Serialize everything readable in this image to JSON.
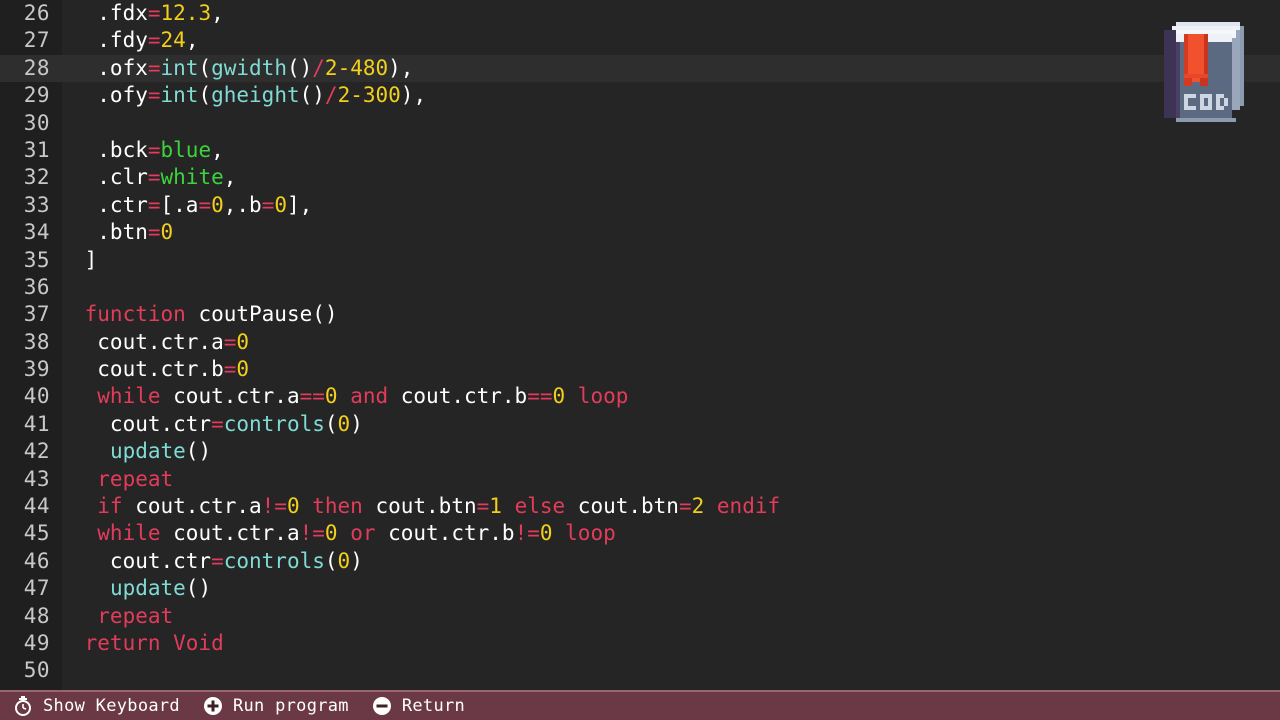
{
  "app": {
    "title": "CODE",
    "logo_label": "CODE"
  },
  "colors": {
    "editor_bg": "#252526",
    "gutter_bg": "#1f1f1f",
    "active_line_bg": "#2e2e2e",
    "line_number": "#c8c8c8",
    "default_text": "#e8e8e8",
    "keyword": "#e23c5a",
    "function": "#7fdbd4",
    "number": "#f2cf1b",
    "constant": "#3cd43c",
    "operator": "#e23c5a",
    "bottombar_bg": "#6b3946",
    "bottombar_border": "#9a6471",
    "bottombar_text": "#ffffff"
  },
  "editor": {
    "active_line": 28,
    "first_visible_line": 26,
    "last_visible_line": 50,
    "lines": [
      {
        "n": 26,
        "tokens": [
          {
            "t": "  .fdx",
            "c": "id"
          },
          {
            "t": "=",
            "c": "op"
          },
          {
            "t": "12.3",
            "c": "num"
          },
          {
            "t": ",",
            "c": "id"
          }
        ]
      },
      {
        "n": 27,
        "tokens": [
          {
            "t": "  .fdy",
            "c": "id"
          },
          {
            "t": "=",
            "c": "op"
          },
          {
            "t": "24",
            "c": "num"
          },
          {
            "t": ",",
            "c": "id"
          }
        ]
      },
      {
        "n": 28,
        "tokens": [
          {
            "t": "  .ofx",
            "c": "id"
          },
          {
            "t": "=",
            "c": "op"
          },
          {
            "t": "int",
            "c": "fn"
          },
          {
            "t": "(",
            "c": "id"
          },
          {
            "t": "gwidth",
            "c": "fn"
          },
          {
            "t": "()",
            "c": "id"
          },
          {
            "t": "/",
            "c": "op"
          },
          {
            "t": "2-480",
            "c": "num"
          },
          {
            "t": "),",
            "c": "id"
          }
        ]
      },
      {
        "n": 29,
        "tokens": [
          {
            "t": "  .ofy",
            "c": "id"
          },
          {
            "t": "=",
            "c": "op"
          },
          {
            "t": "int",
            "c": "fn"
          },
          {
            "t": "(",
            "c": "id"
          },
          {
            "t": "gheight",
            "c": "fn"
          },
          {
            "t": "()",
            "c": "id"
          },
          {
            "t": "/",
            "c": "op"
          },
          {
            "t": "2-300",
            "c": "num"
          },
          {
            "t": "),",
            "c": "id"
          }
        ]
      },
      {
        "n": 30,
        "tokens": []
      },
      {
        "n": 31,
        "tokens": [
          {
            "t": "  .bck",
            "c": "id"
          },
          {
            "t": "=",
            "c": "op"
          },
          {
            "t": "blue",
            "c": "str"
          },
          {
            "t": ",",
            "c": "id"
          }
        ]
      },
      {
        "n": 32,
        "tokens": [
          {
            "t": "  .clr",
            "c": "id"
          },
          {
            "t": "=",
            "c": "op"
          },
          {
            "t": "white",
            "c": "str"
          },
          {
            "t": ",",
            "c": "id"
          }
        ]
      },
      {
        "n": 33,
        "tokens": [
          {
            "t": "  .ctr",
            "c": "id"
          },
          {
            "t": "=",
            "c": "op"
          },
          {
            "t": "[.a",
            "c": "id"
          },
          {
            "t": "=",
            "c": "op"
          },
          {
            "t": "0",
            "c": "num"
          },
          {
            "t": ",.b",
            "c": "id"
          },
          {
            "t": "=",
            "c": "op"
          },
          {
            "t": "0",
            "c": "num"
          },
          {
            "t": "],",
            "c": "id"
          }
        ]
      },
      {
        "n": 34,
        "tokens": [
          {
            "t": "  .btn",
            "c": "id"
          },
          {
            "t": "=",
            "c": "op"
          },
          {
            "t": "0",
            "c": "num"
          }
        ]
      },
      {
        "n": 35,
        "tokens": [
          {
            "t": " ]",
            "c": "id"
          }
        ]
      },
      {
        "n": 36,
        "tokens": []
      },
      {
        "n": 37,
        "tokens": [
          {
            "t": " function",
            "c": "kw"
          },
          {
            "t": " coutPause()",
            "c": "id"
          }
        ]
      },
      {
        "n": 38,
        "tokens": [
          {
            "t": "  cout.ctr.a",
            "c": "id"
          },
          {
            "t": "=",
            "c": "op"
          },
          {
            "t": "0",
            "c": "num"
          }
        ]
      },
      {
        "n": 39,
        "tokens": [
          {
            "t": "  cout.ctr.b",
            "c": "id"
          },
          {
            "t": "=",
            "c": "op"
          },
          {
            "t": "0",
            "c": "num"
          }
        ]
      },
      {
        "n": 40,
        "tokens": [
          {
            "t": "  while",
            "c": "kw"
          },
          {
            "t": " cout.ctr.a",
            "c": "id"
          },
          {
            "t": "==",
            "c": "op"
          },
          {
            "t": "0",
            "c": "num"
          },
          {
            "t": " and",
            "c": "kw"
          },
          {
            "t": " cout.ctr.b",
            "c": "id"
          },
          {
            "t": "==",
            "c": "op"
          },
          {
            "t": "0",
            "c": "num"
          },
          {
            "t": " loop",
            "c": "kw"
          }
        ]
      },
      {
        "n": 41,
        "tokens": [
          {
            "t": "   cout.ctr",
            "c": "id"
          },
          {
            "t": "=",
            "c": "op"
          },
          {
            "t": "controls",
            "c": "fn"
          },
          {
            "t": "(",
            "c": "id"
          },
          {
            "t": "0",
            "c": "num"
          },
          {
            "t": ")",
            "c": "id"
          }
        ]
      },
      {
        "n": 42,
        "tokens": [
          {
            "t": "   ",
            "c": "id"
          },
          {
            "t": "update",
            "c": "fn"
          },
          {
            "t": "()",
            "c": "id"
          }
        ]
      },
      {
        "n": 43,
        "tokens": [
          {
            "t": "  repeat",
            "c": "kw"
          }
        ]
      },
      {
        "n": 44,
        "tokens": [
          {
            "t": "  if",
            "c": "kw"
          },
          {
            "t": " cout.ctr.a",
            "c": "id"
          },
          {
            "t": "!=",
            "c": "op"
          },
          {
            "t": "0",
            "c": "num"
          },
          {
            "t": " then",
            "c": "kw"
          },
          {
            "t": " cout.btn",
            "c": "id"
          },
          {
            "t": "=",
            "c": "op"
          },
          {
            "t": "1",
            "c": "num"
          },
          {
            "t": " else",
            "c": "kw"
          },
          {
            "t": " cout.btn",
            "c": "id"
          },
          {
            "t": "=",
            "c": "op"
          },
          {
            "t": "2",
            "c": "num"
          },
          {
            "t": " endif",
            "c": "kw"
          }
        ]
      },
      {
        "n": 45,
        "tokens": [
          {
            "t": "  while",
            "c": "kw"
          },
          {
            "t": " cout.ctr.a",
            "c": "id"
          },
          {
            "t": "!=",
            "c": "op"
          },
          {
            "t": "0",
            "c": "num"
          },
          {
            "t": " or",
            "c": "kw"
          },
          {
            "t": " cout.ctr.b",
            "c": "id"
          },
          {
            "t": "!=",
            "c": "op"
          },
          {
            "t": "0",
            "c": "num"
          },
          {
            "t": " loop",
            "c": "kw"
          }
        ]
      },
      {
        "n": 46,
        "tokens": [
          {
            "t": "   cout.ctr",
            "c": "id"
          },
          {
            "t": "=",
            "c": "op"
          },
          {
            "t": "controls",
            "c": "fn"
          },
          {
            "t": "(",
            "c": "id"
          },
          {
            "t": "0",
            "c": "num"
          },
          {
            "t": ")",
            "c": "id"
          }
        ]
      },
      {
        "n": 47,
        "tokens": [
          {
            "t": "   ",
            "c": "id"
          },
          {
            "t": "update",
            "c": "fn"
          },
          {
            "t": "()",
            "c": "id"
          }
        ]
      },
      {
        "n": 48,
        "tokens": [
          {
            "t": "  repeat",
            "c": "kw"
          }
        ]
      },
      {
        "n": 49,
        "tokens": [
          {
            "t": " return Void",
            "c": "kw"
          }
        ]
      },
      {
        "n": 50,
        "tokens": []
      }
    ]
  },
  "bottombar": {
    "hints": [
      {
        "icon": "stopwatch-icon",
        "label": "Show Keyboard"
      },
      {
        "icon": "plus-circle-icon",
        "label": "Run program"
      },
      {
        "icon": "minus-circle-icon",
        "label": "Return"
      }
    ]
  }
}
